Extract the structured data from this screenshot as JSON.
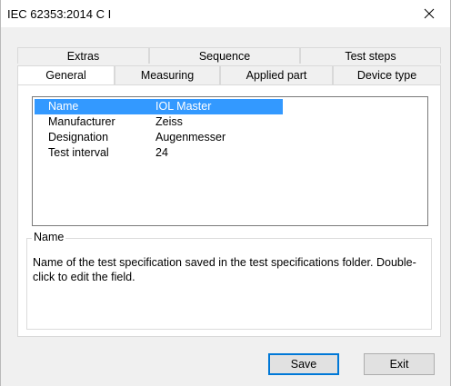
{
  "window": {
    "title": "IEC 62353:2014 C I"
  },
  "tabs": {
    "row1": [
      "Extras",
      "Sequence",
      "Test steps"
    ],
    "row2": [
      "General",
      "Measuring",
      "Applied part",
      "Device type"
    ],
    "active": "General"
  },
  "properties": [
    {
      "label": "Name",
      "value": "IOL Master",
      "selected": true
    },
    {
      "label": "Manufacturer",
      "value": "Zeiss",
      "selected": false
    },
    {
      "label": "Designation",
      "value": "Augenmesser",
      "selected": false
    },
    {
      "label": "Test interval",
      "value": "24",
      "selected": false
    }
  ],
  "description": {
    "title": "Name",
    "text": "Name of the test specification saved in the test specifications folder. Double-click to edit the field."
  },
  "buttons": {
    "save": "Save",
    "exit": "Exit"
  },
  "colors": {
    "selection": "#3399ff",
    "default_button_border": "#0078d7"
  },
  "icons": {
    "close": "close-icon"
  }
}
